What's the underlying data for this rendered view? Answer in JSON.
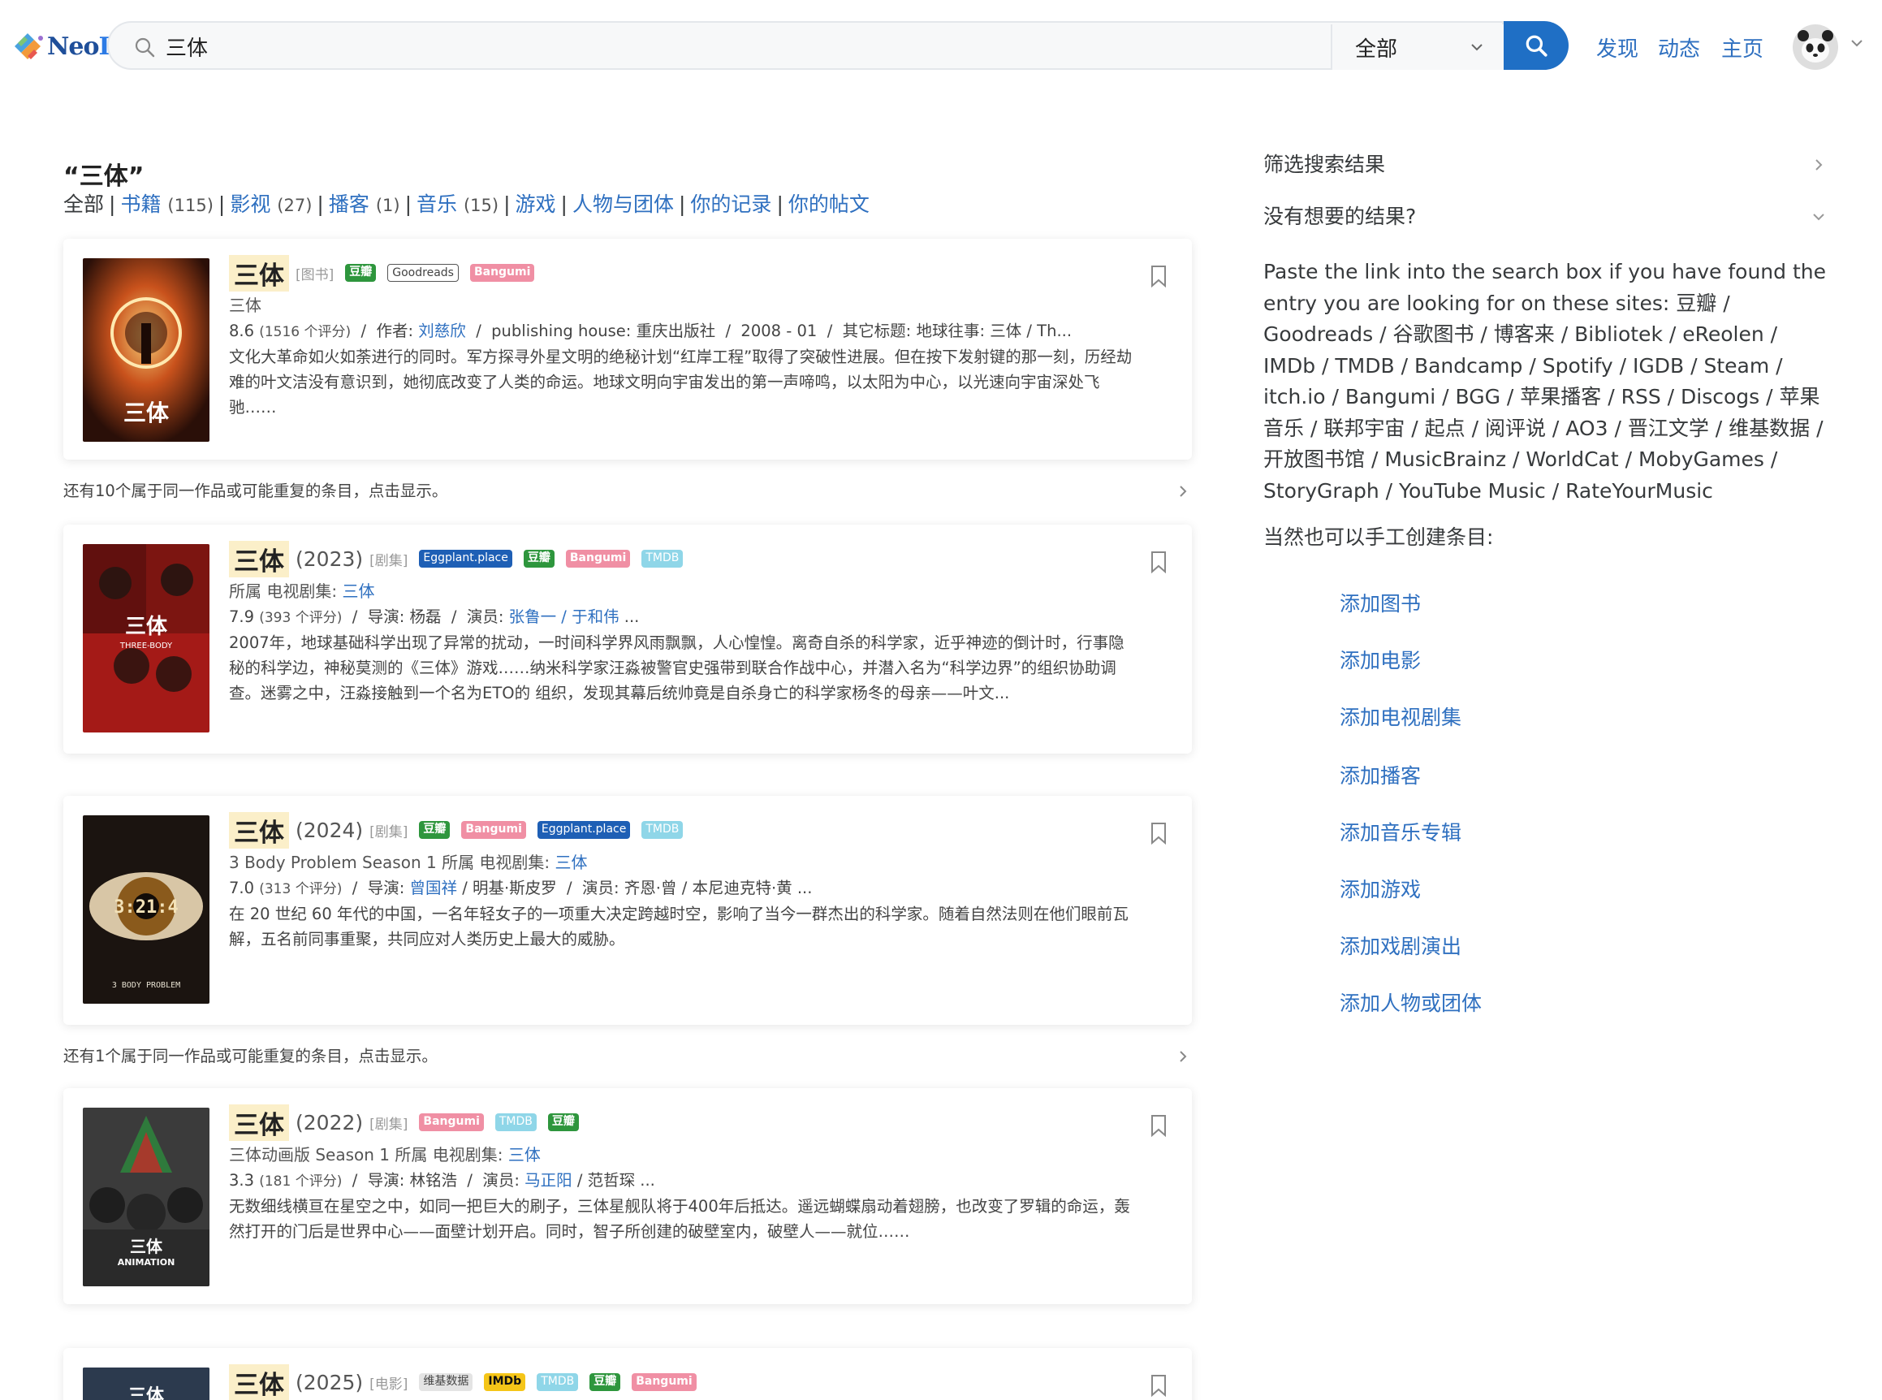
{
  "header": {
    "logo_text_a": "Neo",
    "logo_text_b": "DB",
    "search_value": "三体",
    "search_scope": "全部",
    "nav": [
      "发现",
      "动态",
      "主页"
    ]
  },
  "results_header": {
    "query": "“三体”",
    "all_label": "全部",
    "categories": [
      {
        "label": "书籍",
        "count": "(115)"
      },
      {
        "label": "影视",
        "count": "(27)"
      },
      {
        "label": "播客",
        "count": "(1)"
      },
      {
        "label": "音乐",
        "count": "(15)"
      },
      {
        "label": "游戏",
        "count": ""
      },
      {
        "label": "人物与团体",
        "count": ""
      },
      {
        "label": "你的记录",
        "count": ""
      },
      {
        "label": "你的帖文",
        "count": ""
      }
    ]
  },
  "cards": [
    {
      "title": "三体",
      "year": "",
      "category": "[图书]",
      "badges": [
        "豆瓣",
        "Goodreads",
        "Bangumi"
      ],
      "subtitle_plain": "三体",
      "subtitle_link": "",
      "meta_rating": "8.6",
      "meta_count": "(1516 个评分)",
      "meta_rest_a": "  /  作者: ",
      "meta_link": "刘慈欣",
      "meta_rest_b": "  /  publishing house: 重庆出版社  /  2008 - 01  /  其它标题: 地球往事: 三体 / Th...",
      "desc": "文化大革命如火如荼进行的同时。军方探寻外星文明的绝秘计划“红岸工程”取得了突破性进展。但在按下发射键的那一刻，历经劫难的叶文洁没有意识到，她彻底改变了人类的命运。地球文明向宇宙发出的第一声啼鸣，以太阳为中心，以光速向宇宙深处飞驰……"
    },
    {
      "title": "三体",
      "year": "(2023)",
      "category": "[剧集]",
      "badges": [
        "Eggplant.place",
        "豆瓣",
        "Bangumi",
        "TMDB"
      ],
      "subtitle_plain": "所属 电视剧集: ",
      "subtitle_link": "三体",
      "meta_rating": "7.9",
      "meta_count": "(393 个评分)",
      "meta_rest_a": "  /  导演: 杨磊  /  演员: ",
      "meta_link": "张鲁一 / 于和伟",
      "meta_rest_b": " ...",
      "desc": "2007年，地球基础科学出现了异常的扰动，一时间科学界风雨飘飘，人心惶惶。离奇自杀的科学家，近乎神迹的倒计时，行事隐秘的科学边，神秘莫测的《三体》游戏……纳米科学家汪淼被警官史强带到联合作战中心，并潜入名为“科学边界”的组织协助调查。迷雾之中，汪淼接触到一个名为ETO的 组织，发现其幕后统帅竟是自杀身亡的科学家杨冬的母亲——叶文..."
    },
    {
      "title": "三体",
      "year": "(2024)",
      "category": "[剧集]",
      "badges": [
        "豆瓣",
        "Bangumi",
        "Eggplant.place",
        "TMDB"
      ],
      "subtitle_plain": "3 Body Problem Season 1 所属 电视剧集: ",
      "subtitle_link": "三体",
      "meta_rating": "7.0",
      "meta_count": "(313 个评分)",
      "meta_rest_a": "  /  导演: ",
      "meta_link": "曾国祥",
      "meta_rest_b": " / 明基·斯皮罗  /  演员: 齐恩·曾 / 本尼迪克特·黄 ...",
      "desc": "在 20 世纪 60 年代的中国，一名年轻女子的一项重大决定跨越时空，影响了当今一群杰出的科学家。随着自然法则在他们眼前瓦解，五名前同事重聚，共同应对人类历史上最大的威胁。"
    },
    {
      "title": "三体",
      "year": "(2022)",
      "category": "[剧集]",
      "badges": [
        "Bangumi",
        "TMDB",
        "豆瓣"
      ],
      "subtitle_plain": "三体动画版 Season 1 所属 电视剧集: ",
      "subtitle_link": "三体",
      "meta_rating": "3.3",
      "meta_count": "(181 个评分)",
      "meta_rest_a": "  /  导演: 林铭浩  /  演员: ",
      "meta_link": "马正阳",
      "meta_rest_b": " / 范哲琛 ...",
      "desc": "无数细线横亘在星空之中，如同一把巨大的刷子，三体星舰队将于400年后抵达。遥远蝴蝶扇动着翅膀，也改变了罗辑的命运，轰然打开的门后是世界中心——面壁计划开启。同时，智子所创建的破壁室内，破壁人——就位……"
    },
    {
      "title": "三体",
      "year": "(2025)",
      "category": "[电影]",
      "badges": [
        "维基数据",
        "IMDb",
        "TMDB",
        "豆瓣",
        "Bangumi"
      ]
    }
  ],
  "dup_notes": [
    "还有10个属于同一作品或可能重复的条目，点击显示。",
    "还有1个属于同一作品或可能重复的条目，点击显示。"
  ],
  "cover_texts": [
    "三体",
    "三体",
    "THREE-BODY",
    "3:21:4",
    "3 BODY PROBLEM",
    "三体",
    "ANIMATION",
    "三体"
  ],
  "sidebar": {
    "filter_label": "筛选搜索结果",
    "no_result_label": "没有想要的结果?",
    "paste_text": "Paste the link into the search box if you have found the entry you are looking for on these sites: 豆瓣 / Goodreads / 谷歌图书 / 博客来 / Bibliotek / eReolen / IMDb / TMDB / Bandcamp / Spotify / IGDB / Steam / itch.io / Bangumi / BGG / 苹果播客 / RSS / Discogs / 苹果音乐 / 联邦宇宙 / 起点 / 阅评说 / AO3 / 晋江文学 / 维基数据 / 开放图书馆 / MusicBrainz / WorldCat / MobyGames / StoryGraph / YouTube Music / RateYourMusic",
    "manual_label": "当然也可以手工创建条目:",
    "add_links": [
      "添加图书",
      "添加电影",
      "添加电视剧集",
      "添加播客",
      "添加音乐专辑",
      "添加游戏",
      "添加戏剧演出",
      "添加人物或团体"
    ]
  }
}
